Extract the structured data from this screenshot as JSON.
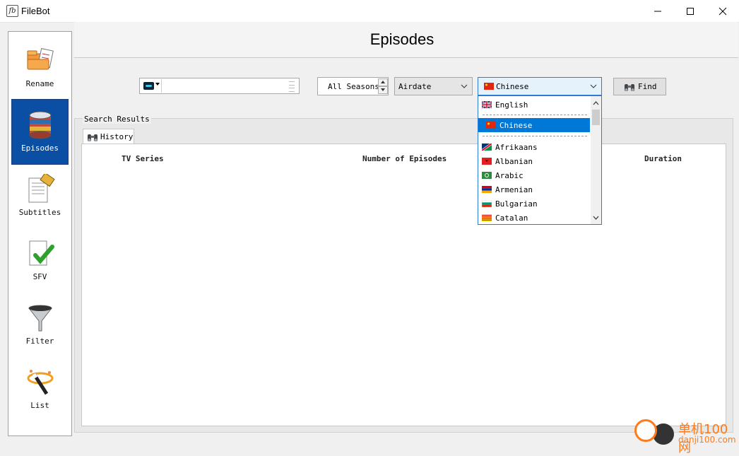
{
  "window": {
    "title": "FileBot",
    "app_icon_text": "fb"
  },
  "sidebar": {
    "items": [
      {
        "label": "Rename"
      },
      {
        "label": "Episodes",
        "selected": true
      },
      {
        "label": "Subtitles"
      },
      {
        "label": "SFV"
      },
      {
        "label": "Filter"
      },
      {
        "label": "List"
      }
    ]
  },
  "header": {
    "title": "Episodes"
  },
  "toolbar": {
    "search": {
      "value": "",
      "placeholder": ""
    },
    "season": "All Seasons",
    "order": "Airdate",
    "language": "Chinese",
    "find_label": "Find"
  },
  "language_dropdown": {
    "options": [
      {
        "label": "English",
        "flag": "gb"
      },
      {
        "label": "Chinese",
        "flag": "cn",
        "selected": true
      },
      {
        "label": "Afrikaans",
        "flag": "na"
      },
      {
        "label": "Albanian",
        "flag": "al"
      },
      {
        "label": "Arabic",
        "flag": "sa"
      },
      {
        "label": "Armenian",
        "flag": "am"
      },
      {
        "label": "Bulgarian",
        "flag": "bg"
      },
      {
        "label": "Catalan",
        "flag": "ca"
      }
    ]
  },
  "results": {
    "title": "Search Results",
    "tab_label": "History",
    "columns": [
      "TV Series",
      "Number of Episodes",
      "Duration"
    ]
  },
  "watermark": {
    "line1": "单机100网",
    "line2": "danji100.com"
  },
  "colors": {
    "accent": "#0078d7",
    "selected_sidebar": "#0a4fa3",
    "watermark": "#ff7a1a"
  }
}
